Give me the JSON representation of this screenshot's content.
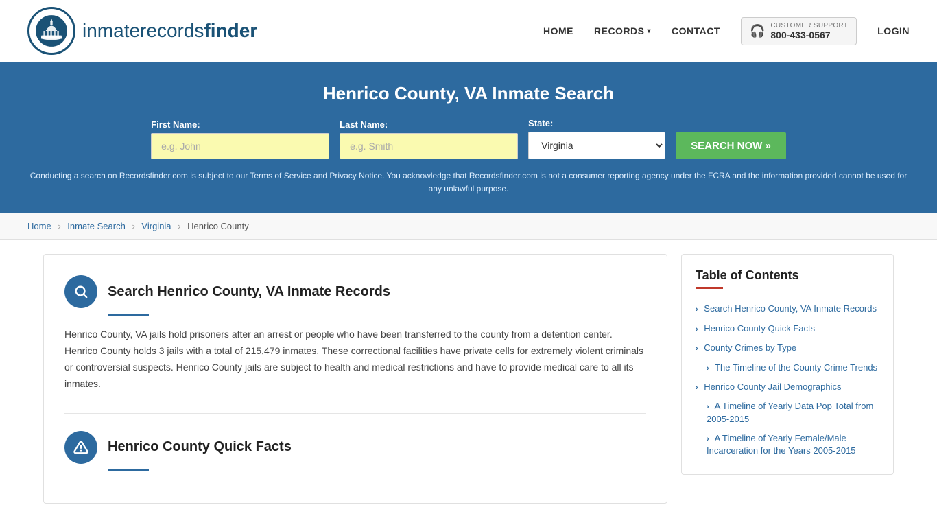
{
  "header": {
    "logo_text_main": "inmaterecords",
    "logo_text_bold": "finder",
    "nav": {
      "home": "HOME",
      "records": "RECORDS",
      "contact": "CONTACT",
      "login": "LOGIN"
    },
    "support": {
      "label": "CUSTOMER SUPPORT",
      "phone": "800-433-0567"
    }
  },
  "hero": {
    "title": "Henrico County, VA Inmate Search",
    "form": {
      "first_name_label": "First Name:",
      "first_name_placeholder": "e.g. John",
      "last_name_label": "Last Name:",
      "last_name_placeholder": "e.g. Smith",
      "state_label": "State:",
      "state_value": "Virginia",
      "search_button": "SEARCH NOW »"
    },
    "disclaimer": "Conducting a search on Recordsfinder.com is subject to our Terms of Service and Privacy Notice. You acknowledge that Recordsfinder.com is not a consumer reporting agency under the FCRA and the information provided cannot be used for any unlawful purpose."
  },
  "breadcrumb": {
    "home": "Home",
    "inmate_search": "Inmate Search",
    "virginia": "Virginia",
    "current": "Henrico County"
  },
  "main": {
    "section1": {
      "title": "Search Henrico County, VA Inmate Records",
      "text": "Henrico County, VA jails hold prisoners after an arrest or people who have been transferred to the county from a detention center. Henrico County holds 3 jails with a total of 215,479 inmates. These correctional facilities have private cells for extremely violent criminals or controversial suspects. Henrico County jails are subject to health and medical restrictions and have to provide medical care to all its inmates."
    },
    "section2": {
      "title": "Henrico County Quick Facts"
    }
  },
  "toc": {
    "title": "Table of Contents",
    "items": [
      {
        "label": "Search Henrico County, VA Inmate Records",
        "sub": false
      },
      {
        "label": "Henrico County Quick Facts",
        "sub": false
      },
      {
        "label": "County Crimes by Type",
        "sub": false
      },
      {
        "label": "The Timeline of the County Crime Trends",
        "sub": true
      },
      {
        "label": "Henrico County Jail Demographics",
        "sub": false
      },
      {
        "label": "A Timeline of Yearly Data Pop Total from 2005-2015",
        "sub": true
      },
      {
        "label": "A Timeline of Yearly Female/Male Incarceration for the Years 2005-2015",
        "sub": true
      }
    ]
  }
}
